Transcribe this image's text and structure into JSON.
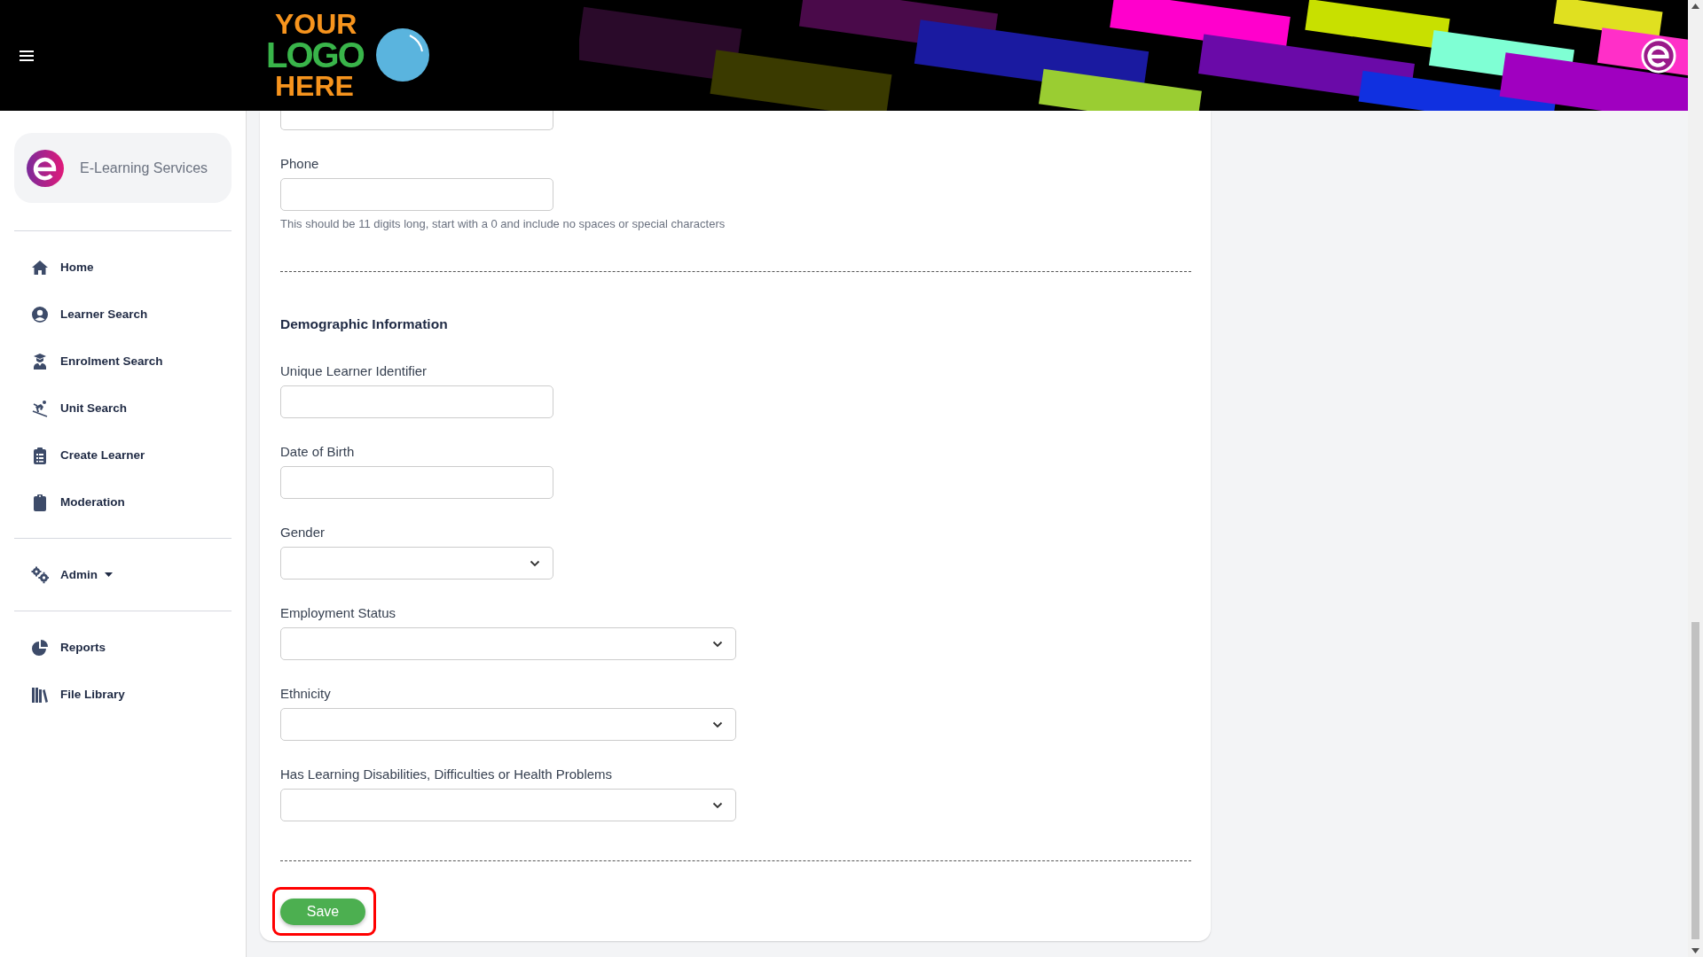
{
  "header": {
    "logo": [
      "YOUR",
      "LOGO",
      "HERE"
    ]
  },
  "sidebar": {
    "brand": "E-Learning Services",
    "sections": [
      [
        {
          "label": "Home",
          "dropdown": false
        },
        {
          "label": "Learner Search",
          "dropdown": false
        },
        {
          "label": "Enrolment Search",
          "dropdown": false
        },
        {
          "label": "Unit Search",
          "dropdown": false
        },
        {
          "label": "Create Learner",
          "dropdown": false
        },
        {
          "label": "Moderation",
          "dropdown": false
        }
      ],
      [
        {
          "label": "Admin",
          "dropdown": true
        }
      ],
      [
        {
          "label": "Reports",
          "dropdown": false
        },
        {
          "label": "File Library",
          "dropdown": false
        }
      ]
    ]
  },
  "form": {
    "top_field": {
      "kind": "text"
    },
    "contact_fields": [
      {
        "label": "Phone",
        "kind": "text",
        "hint": "This should be 11 digits long, start with a 0 and include no spaces or special characters"
      }
    ],
    "section_title": "Demographic Information",
    "fields": [
      {
        "label": "Unique Learner Identifier",
        "kind": "text"
      },
      {
        "label": "Date of Birth",
        "kind": "text"
      },
      {
        "label": "Gender",
        "kind": "select"
      },
      {
        "label": "Employment Status",
        "kind": "select-wide"
      },
      {
        "label": "Ethnicity",
        "kind": "select-wide"
      },
      {
        "label": "Has Learning Disabilities, Difficulties or Health Problems",
        "kind": "select-wide"
      }
    ],
    "save": {
      "label": "Save",
      "highlighted": true
    }
  }
}
